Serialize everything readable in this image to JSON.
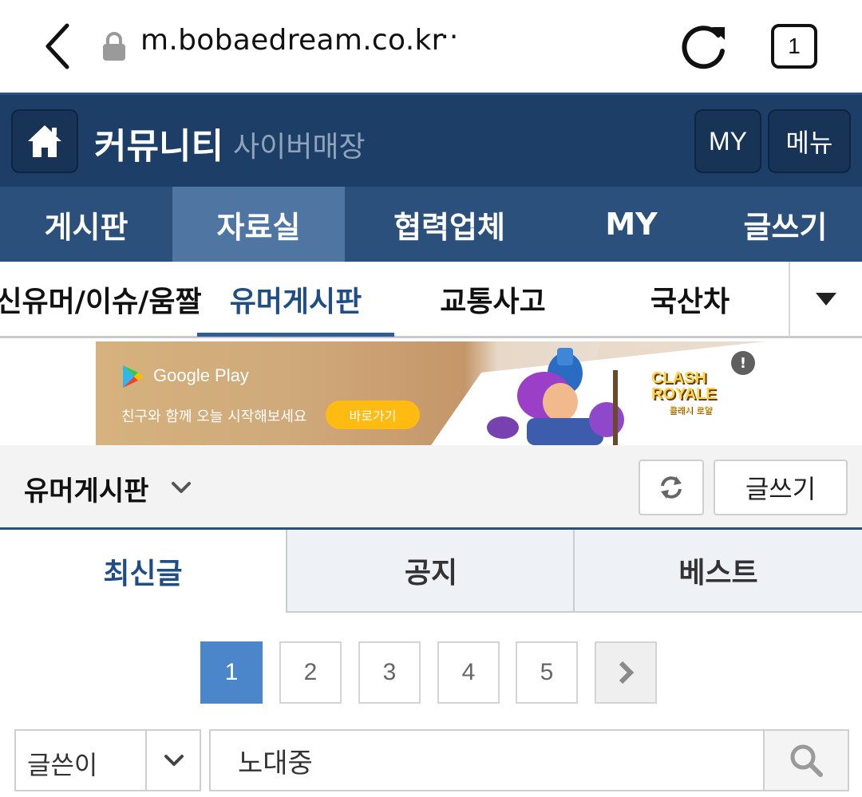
{
  "browser": {
    "url": "m.bobaedream.co.kr",
    "url_more": "···",
    "tab_count": "1"
  },
  "header": {
    "title": "커뮤니티",
    "subtitle": "사이버매장",
    "my_label": "MY",
    "menu_label": "메뉴"
  },
  "main_nav": {
    "items": [
      {
        "label": "게시판"
      },
      {
        "label": "자료실"
      },
      {
        "label": "협력업체"
      },
      {
        "label": "MY"
      },
      {
        "label": "글쓰기"
      }
    ],
    "active": "자료실"
  },
  "sub_nav": {
    "items": [
      {
        "label": "신유머/이슈/움짤"
      },
      {
        "label": "유머게시판"
      },
      {
        "label": "교통사고"
      },
      {
        "label": "국산차"
      }
    ],
    "active": "유머게시판"
  },
  "ad": {
    "store": "Google Play",
    "tagline": "친구와 함께 오늘 시작해보세요",
    "cta": "바로가기",
    "game_title_1": "CLASH",
    "game_title_2": "ROYALE",
    "game_sub": "클래시 로얄",
    "info": "!"
  },
  "board": {
    "title": "유머게시판",
    "write_label": "글쓰기"
  },
  "filter_tabs": [
    {
      "label": "최신글"
    },
    {
      "label": "공지"
    },
    {
      "label": "베스트"
    }
  ],
  "pagination": {
    "pages": [
      "1",
      "2",
      "3",
      "4",
      "5"
    ],
    "current": "1"
  },
  "search": {
    "type": "글쓴이",
    "value": "노대중"
  },
  "colors": {
    "header_bg": "#1d3e66",
    "nav_bg": "#2b507c",
    "nav_active": "#4f76a2",
    "accent": "#1f4e86",
    "page_active": "#4a86c9"
  }
}
